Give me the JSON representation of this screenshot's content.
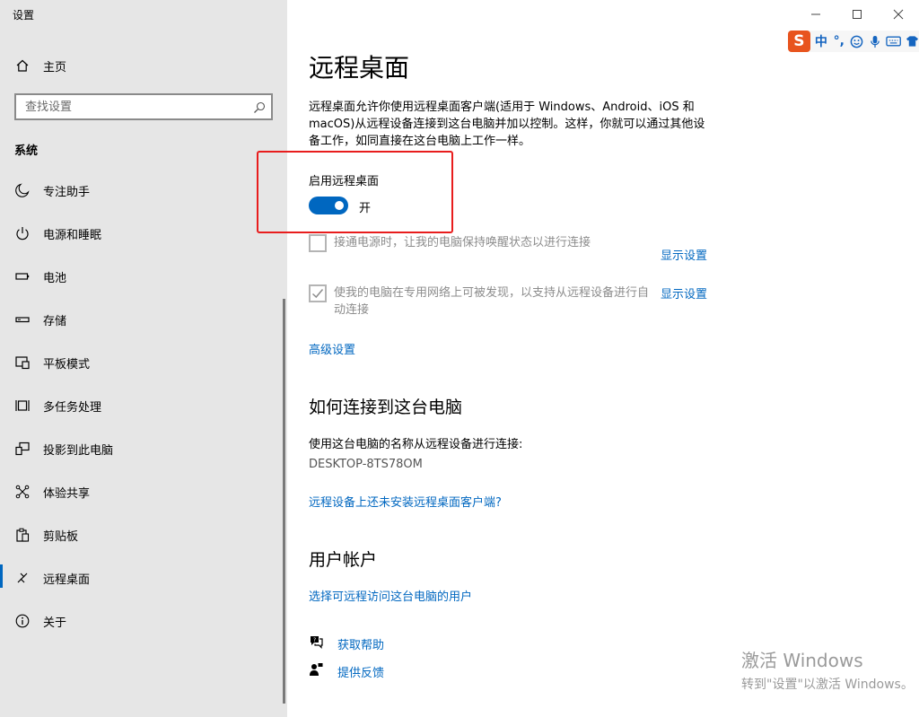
{
  "window": {
    "title": "设置",
    "minimize_label": "Minimize",
    "maximize_label": "Maximize",
    "close_label": "Close"
  },
  "sidebar": {
    "home_label": "主页",
    "search_placeholder": "查找设置",
    "section_title": "系统",
    "items": [
      {
        "label": "专注助手",
        "icon": "moon-icon"
      },
      {
        "label": "电源和睡眠",
        "icon": "power-icon"
      },
      {
        "label": "电池",
        "icon": "battery-icon"
      },
      {
        "label": "存储",
        "icon": "storage-icon"
      },
      {
        "label": "平板模式",
        "icon": "tablet-mode-icon"
      },
      {
        "label": "多任务处理",
        "icon": "multitasking-icon"
      },
      {
        "label": "投影到此电脑",
        "icon": "project-icon"
      },
      {
        "label": "体验共享",
        "icon": "shared-experience-icon"
      },
      {
        "label": "剪贴板",
        "icon": "clipboard-icon"
      },
      {
        "label": "远程桌面",
        "icon": "remote-desktop-icon",
        "active": true
      },
      {
        "label": "关于",
        "icon": "info-icon"
      }
    ]
  },
  "ime": {
    "logo": "S",
    "items": [
      "中",
      "°,",
      "☺",
      "mic",
      "keyboard",
      "shirt"
    ]
  },
  "main": {
    "title": "远程桌面",
    "description": "远程桌面允许你使用远程桌面客户端(适用于 Windows、Android、iOS 和 macOS)从远程设备连接到这台电脑并加以控制。这样，你就可以通过其他设备工作，如同直接在这台电脑上工作一样。",
    "toggle_label": "启用远程桌面",
    "toggle_state": "开",
    "toggle_on": true,
    "option1_text": "接通电源时，让我的电脑保持唤醒状态以进行连接",
    "option1_link": "显示设置",
    "option2_text": "使我的电脑在专用网络上可被发现，以支持从远程设备进行自动连接",
    "option2_link": "显示设置",
    "advanced_link": "高级设置",
    "connect_heading": "如何连接到这台电脑",
    "connect_text": "使用这台电脑的名称从远程设备进行连接:",
    "pc_name": "DESKTOP-8TS78OM",
    "client_link": "远程设备上还未安装远程桌面客户端?",
    "accounts_heading": "用户帐户",
    "accounts_link": "选择可远程访问这台电脑的用户",
    "help_link": "获取帮助",
    "feedback_link": "提供反馈"
  },
  "watermark": {
    "line1": "激活 Windows",
    "line2": "转到\"设置\"以激活 Windows。"
  },
  "colors": {
    "accent": "#0067c0",
    "highlight_box": "#e81d1d",
    "sidebar_bg": "#e6e6e6"
  }
}
